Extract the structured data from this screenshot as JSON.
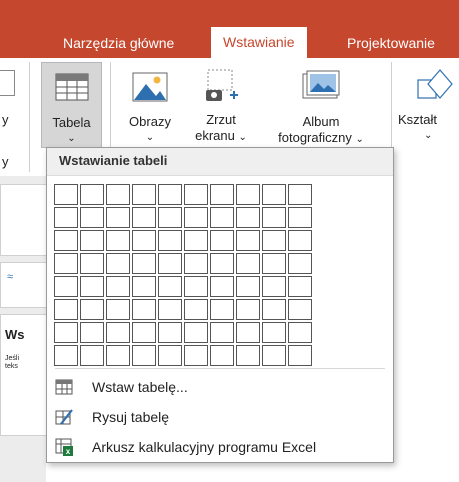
{
  "tabs": {
    "home": "Narzędzia główne",
    "insert": "Wstawianie",
    "design": "Projektowanie"
  },
  "ribbon": {
    "left_partial_1": "y",
    "left_partial_2": "y",
    "table": "Tabela",
    "pictures": "Obrazy",
    "screenshot_line1": "Zrzut",
    "screenshot_line2": "ekranu",
    "album_line1": "Album",
    "album_line2": "fotograficzny",
    "shapes": "Kształt",
    "chevron": "⌄"
  },
  "popup": {
    "title": "Wstawianie tabeli",
    "grid_columns": 10,
    "grid_rows": 8,
    "items": [
      {
        "label": "Wstaw tabelę..."
      },
      {
        "label": "Rysuj tabelę"
      },
      {
        "label": "Arkusz kalkulacyjny programu Excel"
      }
    ]
  },
  "background": {
    "slide_title_fragment": "Ws",
    "slide_text_1": "Jeśli",
    "slide_text_2": "teks"
  },
  "colors": {
    "accent": "#c5472e"
  }
}
